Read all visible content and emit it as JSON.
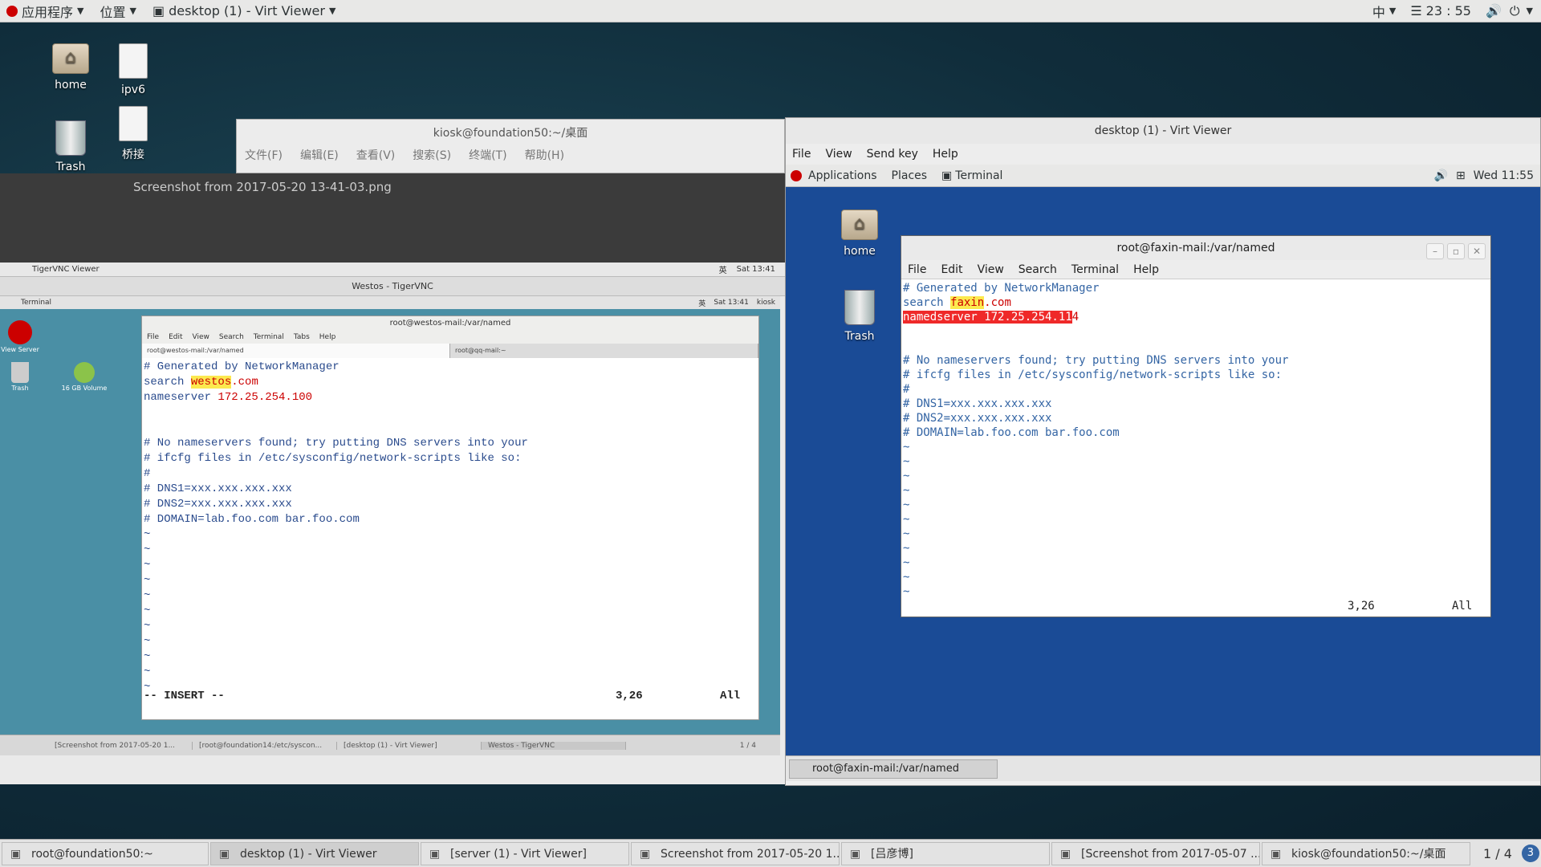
{
  "host_top": {
    "apps": "应用程序",
    "places": "位置",
    "window": "desktop (1) - Virt Viewer",
    "ime": "中",
    "clock": "23 : 55"
  },
  "host_desktop": {
    "icons": [
      "home",
      "ipv6",
      "Trash",
      "桥接"
    ]
  },
  "host_terminal": {
    "title": "kiosk@foundation50:~/桌面",
    "menu": [
      "文件(F)",
      "编辑(E)",
      "查看(V)",
      "搜索(S)",
      "终端(T)",
      "帮助(H)"
    ]
  },
  "screenshot_label": "Screenshot from 2017-05-20 13-41-03.png",
  "vnc": {
    "top_app": "TigerVNC Viewer",
    "top_ime": "英",
    "top_clock": "Sat 13:41",
    "title": "Westos - TigerVNC",
    "gnome_terminal": "Terminal",
    "gnome_ime": "英",
    "gnome_clock": "Sat 13:41",
    "gnome_user": "kiosk",
    "desk_icons": [
      "View Server",
      "Trash",
      "16 GB Volume"
    ],
    "term_title": "root@westos-mail:/var/named",
    "term_menu": [
      "File",
      "Edit",
      "View",
      "Search",
      "Terminal",
      "Tabs",
      "Help"
    ],
    "tabs": [
      "root@westos-mail:/var/named",
      "root@qq-mail:~"
    ],
    "lines": {
      "l1": "# Generated by NetworkManager",
      "l2a": "search ",
      "l2b": "westos",
      ".": "",
      "l2c": ".com",
      "l3a": "nameserver ",
      "l3b": "172.25.254.100",
      "l4": "# No nameservers found; try putting DNS servers into your",
      "l5": "# ifcfg files in /etc/sysconfig/network-scripts like so:",
      "l6": "#",
      "l7": "# DNS1=xxx.xxx.xxx.xxx",
      "l8": "# DNS2=xxx.xxx.xxx.xxx",
      "l9": "# DOMAIN=lab.foo.com bar.foo.com"
    },
    "status_mode": "-- INSERT --",
    "status_pos": "3,26",
    "status_all": "All",
    "taskbar": [
      "[Screenshot from 2017-05-20 1...",
      "[root@foundation14:/etc/syscon...",
      "[desktop (1) - Virt Viewer]",
      "Westos - TigerVNC"
    ],
    "pager": "1 / 4"
  },
  "virt": {
    "title": "desktop (1) - Virt Viewer",
    "menu": [
      "File",
      "View",
      "Send key",
      "Help"
    ],
    "guest_apps": "Applications",
    "guest_places": "Places",
    "guest_terminal": "Terminal",
    "guest_clock": "Wed 11:55",
    "guest_icons": [
      "home",
      "Trash"
    ],
    "term_title": "root@faxin-mail:/var/named",
    "term_menu": [
      "File",
      "Edit",
      "View",
      "Search",
      "Terminal",
      "Help"
    ],
    "lines": {
      "l1": "# Generated by NetworkManager",
      "l2a": "search ",
      "l2b": "faxin",
      "l2c": ".com",
      "l3a": "namedserver 172.25.254.11",
      "l3b": "4",
      "l4": "# No nameservers found; try putting DNS servers into your",
      "l5": "# ifcfg files in /etc/sysconfig/network-scripts like so:",
      "l6": "#",
      "l7": "# DNS1=xxx.xxx.xxx.xxx",
      "l8": "# DNS2=xxx.xxx.xxx.xxx",
      "l9": "# DOMAIN=lab.foo.com bar.foo.com"
    },
    "status_pos": "3,26",
    "status_all": "All",
    "guest_task": "root@faxin-mail:/var/named"
  },
  "host_taskbar": {
    "items": [
      "root@foundation50:~",
      "desktop (1) - Virt Viewer",
      "[server (1) - Virt Viewer]",
      "Screenshot from 2017-05-20 1...",
      "[吕彦博]",
      "[Screenshot from 2017-05-07 ...",
      "kiosk@foundation50:~/桌面"
    ],
    "pager": "1 / 4"
  }
}
